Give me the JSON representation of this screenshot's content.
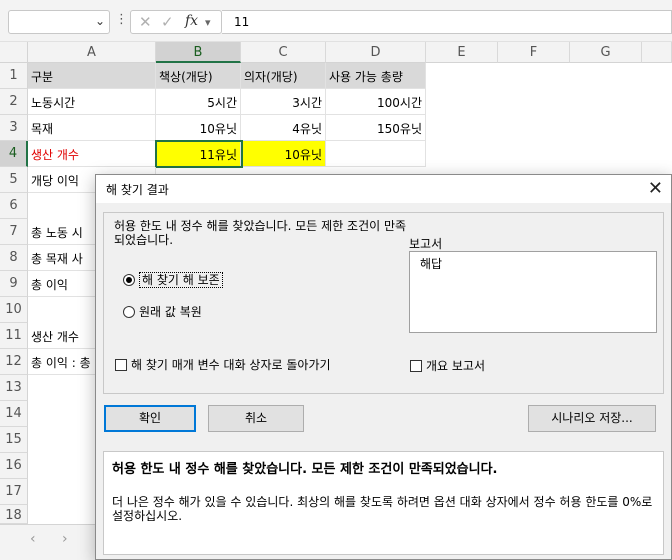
{
  "formula_bar": {
    "name_box": "",
    "formula": "11",
    "fx": "fx"
  },
  "columns": [
    "A",
    "B",
    "C",
    "D",
    "E",
    "F",
    "G"
  ],
  "rows": [
    "1",
    "2",
    "3",
    "4",
    "5",
    "6",
    "7",
    "8",
    "9",
    "10",
    "11",
    "12",
    "13",
    "14",
    "15",
    "16",
    "17",
    "18"
  ],
  "cells": {
    "A1": "구분",
    "B1": "책상(개당)",
    "C1": "의자(개당)",
    "D1": "사용 가능 총량",
    "A2": "노동시간",
    "B2": "5시간",
    "C2": "3시간",
    "D2": "100시간",
    "A3": "목재",
    "B3": "10유닛",
    "C3": "4유닛",
    "D3": "150유닛",
    "A4": "생산 개수",
    "B4": "11유닛",
    "C4": "10유닛",
    "A5": "개당 이익",
    "A7": "총 노동 시",
    "A8": "총 목재 사",
    "A9": "총 이익",
    "A11": "생산 개수",
    "A12": "총 이익 : 총"
  },
  "dialog": {
    "title": "해 찾기 결과",
    "message": "허용 한도 내 정수 해를 찾았습니다. 모든 제한 조건이 만족되었습니다.",
    "radio_keep": "해 찾기 해 보존",
    "radio_restore": "원래 값 복원",
    "reports_label": "보고서",
    "reports": [
      "해답"
    ],
    "return_to_dialog": "해 찾기 매개 변수 대화 상자로 돌아가기",
    "outline_reports": "개요 보고서",
    "ok": "확인",
    "cancel": "취소",
    "save_scenario": "시나리오 저장...",
    "desc_title": "허용 한도 내 정수 해를 찾았습니다. 모든 제한 조건이 만족되었습니다.",
    "desc_body": "더 나은 정수 해가 있을 수 있습니다. 최상의 해를 찾도록 하려면 옵션 대화 상자에서 정수 허용 한도를 0%로 설정하십시오."
  }
}
